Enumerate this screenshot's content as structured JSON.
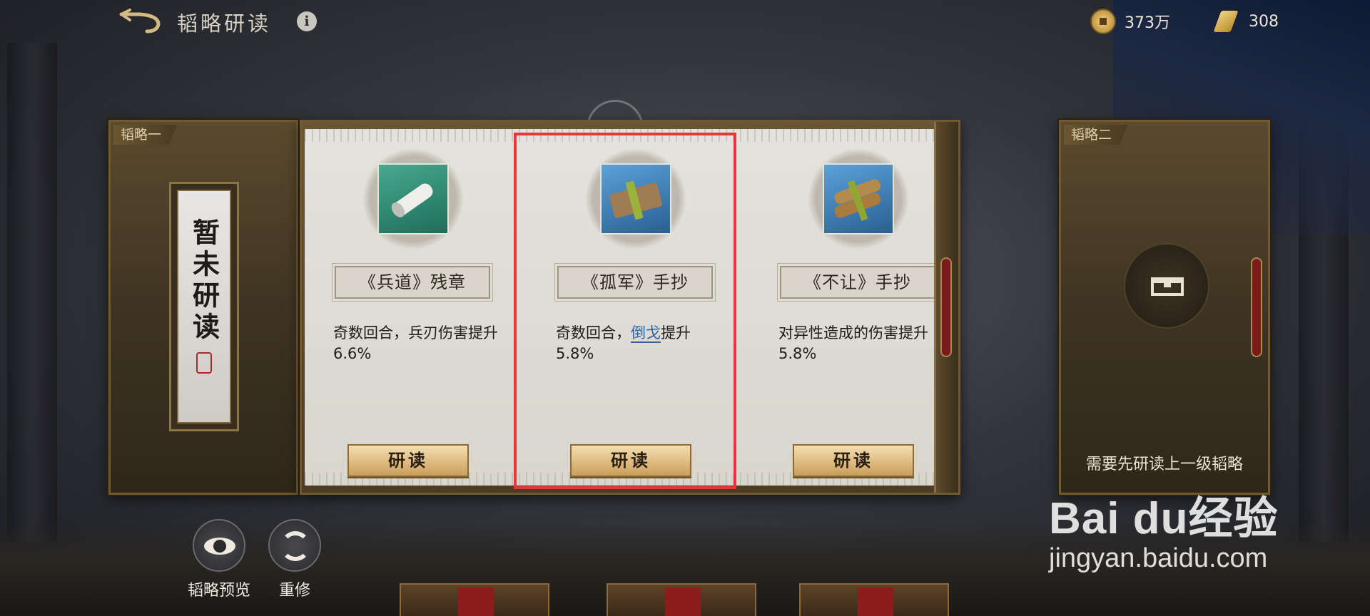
{
  "header": {
    "title": "韬略研读",
    "back_icon": "back-arrow-icon",
    "info_icon": "info-icon",
    "currency": [
      {
        "icon": "coin-icon",
        "value": "373万"
      },
      {
        "icon": "scroll-icon",
        "value": "308"
      }
    ]
  },
  "slot_one": {
    "tag": "韬略一",
    "status": "暂未研读"
  },
  "cards": [
    {
      "name": "《兵道》残章",
      "desc": "奇数回合，兵刃伤害提升6.6%",
      "button": "研读",
      "icon": "scroll-roll-icon"
    },
    {
      "name": "《孤军》手抄",
      "desc_before": "奇数回合，",
      "desc_keyword": "倒戈",
      "desc_after": "提升5.8%",
      "button": "研读",
      "icon": "bamboo-bundle-icon"
    },
    {
      "name": "《不让》手抄",
      "desc": "对异性造成的伤害提升5.8%",
      "button": "研读",
      "icon": "bamboo-scrolls-icon"
    }
  ],
  "slot_two": {
    "tag": "韬略二",
    "locked_note": "需要先研读上一级韬略",
    "icon": "locked-slot-icon"
  },
  "bottom": {
    "preview_label": "韬略预览",
    "reset_label": "重修"
  },
  "watermark": {
    "main": "Bai du经验",
    "sub": "jingyan.baidu.com"
  },
  "colors": {
    "highlight": "#e8353a",
    "keyword": "#2f63a6",
    "button": "#dcb87d"
  }
}
